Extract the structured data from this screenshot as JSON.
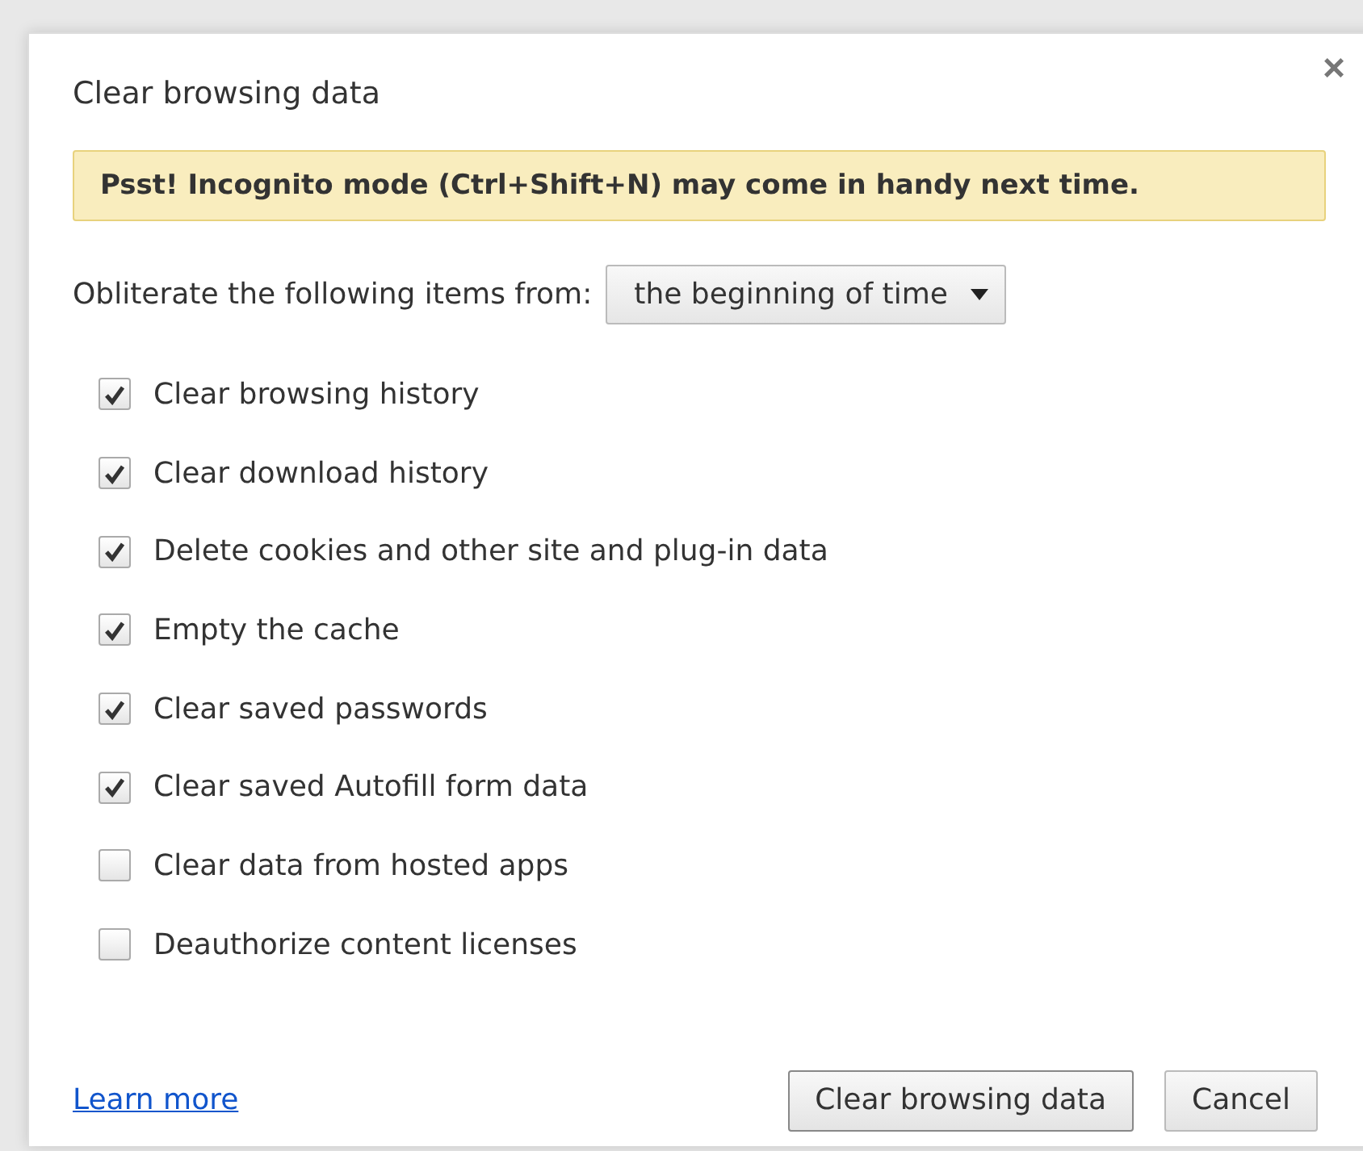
{
  "dialog": {
    "title": "Clear browsing data",
    "close": "×"
  },
  "banner": "Psst! Incognito mode (Ctrl+Shift+N) may come in handy next time.",
  "range": {
    "label": "Obliterate the following items from:",
    "value": "the beginning of time"
  },
  "options": [
    {
      "label": "Clear browsing history",
      "checked": true
    },
    {
      "label": "Clear download history",
      "checked": true
    },
    {
      "label": "Delete cookies and other site and plug-in data",
      "checked": true
    },
    {
      "label": "Empty the cache",
      "checked": true
    },
    {
      "label": "Clear saved passwords",
      "checked": true
    },
    {
      "label": "Clear saved Autofill form data",
      "checked": true
    },
    {
      "label": "Clear data from hosted apps",
      "checked": false
    },
    {
      "label": "Deauthorize content licenses",
      "checked": false
    }
  ],
  "link": "Learn more",
  "buttons": [
    "Clear browsing data",
    "Cancel"
  ]
}
